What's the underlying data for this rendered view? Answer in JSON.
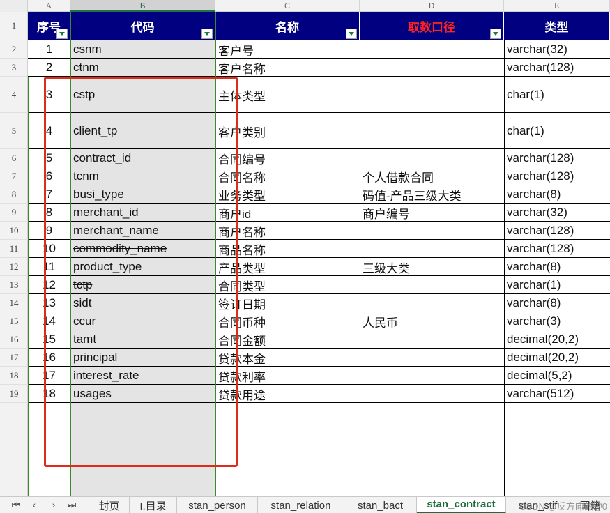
{
  "columns": [
    "A",
    "B",
    "C",
    "D",
    "E"
  ],
  "row_numbers": [
    "1",
    "2",
    "3",
    "4",
    "5",
    "6",
    "7",
    "8",
    "9",
    "10",
    "11",
    "12",
    "13",
    "14",
    "15",
    "16",
    "17",
    "18",
    "19"
  ],
  "headers": {
    "seq": "序号",
    "code": "代码",
    "name": "名称",
    "source": "取数口径",
    "type": "类型"
  },
  "rows": [
    {
      "seq": "1",
      "code": "csnm",
      "name": "客户号",
      "source": "",
      "type": "varchar(32)"
    },
    {
      "seq": "2",
      "code": "ctnm",
      "name": "客户名称",
      "source": "",
      "type": "varchar(128)"
    },
    {
      "seq": "3",
      "code": "cstp",
      "name": "主体类型",
      "source": "",
      "type": "char(1)"
    },
    {
      "seq": "4",
      "code": "client_tp",
      "name": "客户类别",
      "source": "",
      "type": "char(1)"
    },
    {
      "seq": "5",
      "code": "contract_id",
      "name": "合同编号",
      "source": "",
      "type": "varchar(128)"
    },
    {
      "seq": "6",
      "code": "tcnm",
      "name": "合同名称",
      "source": "个人借款合同",
      "type": "varchar(128)"
    },
    {
      "seq": "7",
      "code": "busi_type",
      "name": "业务类型",
      "source": "码值-产品三级大类",
      "type": "varchar(8)"
    },
    {
      "seq": "8",
      "code": "merchant_id",
      "name": "商户id",
      "source": "商户编号",
      "type": "varchar(32)"
    },
    {
      "seq": "9",
      "code": "merchant_name",
      "name": "商户名称",
      "source": "",
      "type": "varchar(128)"
    },
    {
      "seq": "10",
      "code": "commodity_name",
      "name": "商品名称",
      "source": "",
      "type": "varchar(128)"
    },
    {
      "seq": "11",
      "code": "product_type",
      "name": "产品类型",
      "source": "三级大类",
      "type": "varchar(8)"
    },
    {
      "seq": "12",
      "code": "tctp",
      "name": "合同类型",
      "source": "",
      "type": "varchar(1)"
    },
    {
      "seq": "13",
      "code": "sidt",
      "name": "签订日期",
      "source": "",
      "type": "varchar(8)"
    },
    {
      "seq": "14",
      "code": "ccur",
      "name": "合同币种",
      "source": "人民币",
      "type": "varchar(3)"
    },
    {
      "seq": "15",
      "code": "tamt",
      "name": "合同金额",
      "source": "",
      "type": "decimal(20,2)"
    },
    {
      "seq": "16",
      "code": "principal",
      "name": "贷款本金",
      "source": "",
      "type": "decimal(20,2)"
    },
    {
      "seq": "17",
      "code": "interest_rate",
      "name": "贷款利率",
      "source": "",
      "type": "decimal(5,2)"
    },
    {
      "seq": "18",
      "code": "usages",
      "name": "贷款用途",
      "source": "",
      "type": "varchar(512)"
    }
  ],
  "struck_rows": [
    10,
    12
  ],
  "sheet_tabs": [
    "封页",
    "I.目录",
    "stan_person",
    "stan_relation",
    "stan_bact",
    "stan_contract",
    "stan_stif",
    "国籍"
  ],
  "active_tab": "stan_contract",
  "nav_icons": [
    "first-sheet-icon",
    "prev-sheet-icon",
    "next-sheet-icon",
    "last-sheet-icon"
  ],
  "watermark": "CSDN @反方向的钟0",
  "colors": {
    "header_bg": "#000080",
    "header_text": "#ffffff",
    "source_header_text": "#ff2020",
    "selection_green": "#3a8a2a",
    "highlight_box": "#e02a1a"
  }
}
